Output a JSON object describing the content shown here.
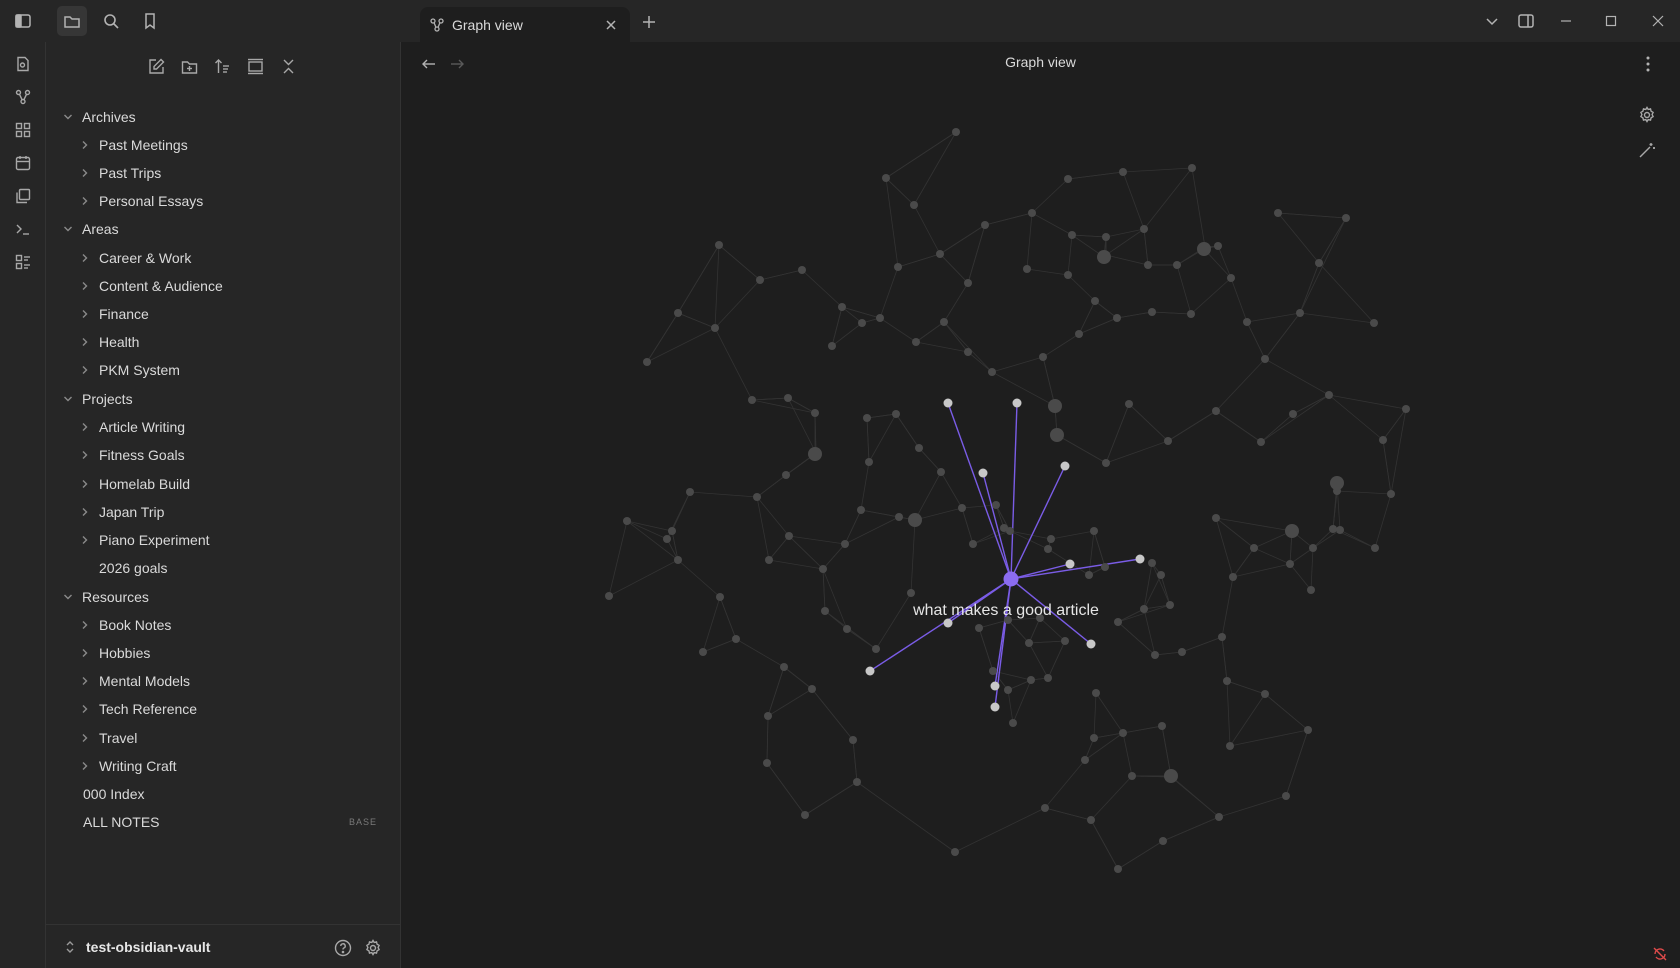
{
  "window": {
    "tab_label": "Graph view",
    "tab_icon": "graph-icon"
  },
  "ribbon": {
    "icons": [
      "open-quick-switcher-icon",
      "graph-icon",
      "canvas-icon",
      "daily-note-icon",
      "templates-icon",
      "command-palette-icon",
      "bases-icon"
    ]
  },
  "sidebar": {
    "toolbar": [
      "new-note-icon",
      "new-folder-icon",
      "sort-icon",
      "auto-reveal-icon",
      "collapse-all-icon"
    ],
    "folders": {
      "archives": "Archives",
      "past_meetings": "Past Meetings",
      "past_trips": "Past Trips",
      "personal_essays": "Personal Essays",
      "areas": "Areas",
      "career_work": "Career & Work",
      "content_audience": "Content & Audience",
      "finance": "Finance",
      "health": "Health",
      "pkm_system": "PKM System",
      "projects": "Projects",
      "article_writing": "Article Writing",
      "fitness_goals": "Fitness Goals",
      "homelab_build": "Homelab Build",
      "japan_trip": "Japan Trip",
      "piano_experiment": "Piano Experiment",
      "goals_2026": "2026 goals",
      "resources": "Resources",
      "book_notes": "Book Notes",
      "hobbies": "Hobbies",
      "mental_models": "Mental Models",
      "tech_reference": "Tech Reference",
      "travel": "Travel",
      "writing_craft": "Writing Craft",
      "index_000": "000 Index",
      "all_notes": "ALL NOTES",
      "all_notes_badge": "BASE"
    },
    "vault_name": "test-obsidian-vault"
  },
  "main": {
    "title": "Graph view",
    "focused_node_label": "what makes a good article",
    "colors": {
      "accent": "#8b6cf0",
      "edge_active": "#7a5ce6",
      "node": "#4a4a4a",
      "node_linked": "#c8c8c8",
      "edge": "#333333"
    }
  }
}
